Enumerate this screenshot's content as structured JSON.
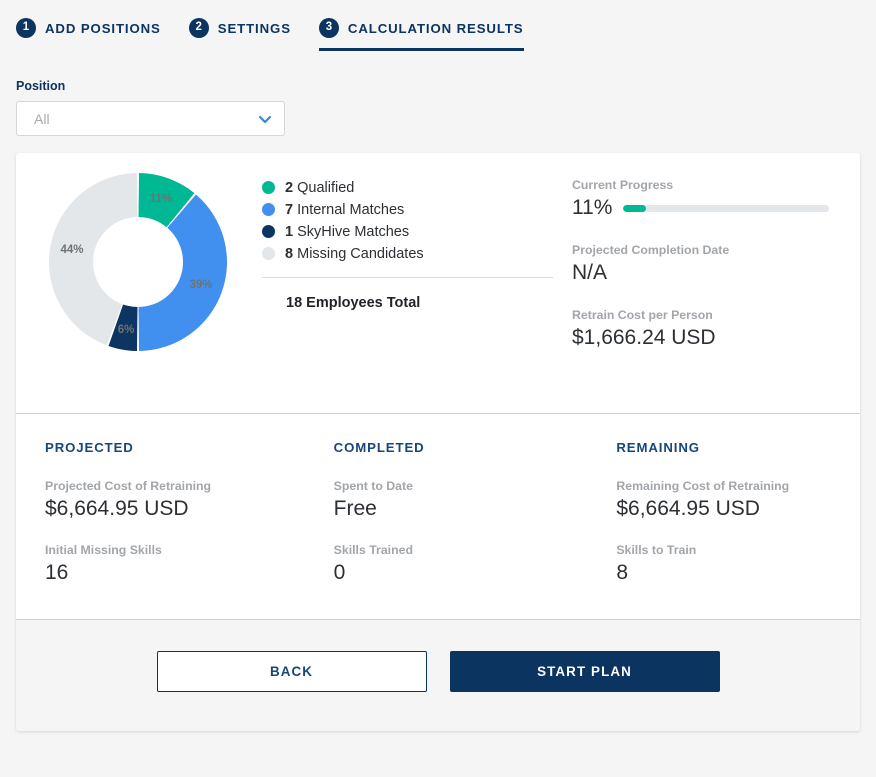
{
  "stepper": {
    "steps": [
      {
        "num": "1",
        "label": "ADD POSITIONS",
        "active": false
      },
      {
        "num": "2",
        "label": "SETTINGS",
        "active": false
      },
      {
        "num": "3",
        "label": "CALCULATION RESULTS",
        "active": true
      }
    ]
  },
  "filter": {
    "label": "Position",
    "value": "All",
    "placeholder": "All"
  },
  "chart_data": {
    "type": "pie",
    "title": "",
    "categories": [
      "Qualified",
      "Internal Matches",
      "SkyHive Matches",
      "Missing Candidates"
    ],
    "values": [
      2,
      7,
      1,
      8
    ],
    "percent_labels": [
      "11%",
      "39%",
      "6%",
      "44%"
    ],
    "colors": [
      "#00b894",
      "#4190f0",
      "#0d3561",
      "#e3e7ea"
    ],
    "total": 18,
    "total_label": "18 Employees Total",
    "legend_position": "right",
    "donut": true
  },
  "legend": [
    {
      "count": "2",
      "label": "Qualified",
      "color": "#00b894"
    },
    {
      "count": "7",
      "label": "Internal Matches",
      "color": "#4190f0"
    },
    {
      "count": "1",
      "label": "SkyHive Matches",
      "color": "#0d3561"
    },
    {
      "count": "8",
      "label": "Missing Candidates",
      "color": "#e3e7ea"
    }
  ],
  "legend_total": "18 Employees Total",
  "side_stats": {
    "progress": {
      "label": "Current Progress",
      "value": "11%",
      "percent": 11
    },
    "completion": {
      "label": "Projected Completion Date",
      "value": "N/A"
    },
    "retrain_cost": {
      "label": "Retrain Cost per Person",
      "value": "$1,666.24 USD"
    }
  },
  "stats_columns": [
    {
      "head": "PROJECTED",
      "items": [
        {
          "label": "Projected Cost of Retraining",
          "value": "$6,664.95 USD"
        },
        {
          "label": "Initial Missing Skills",
          "value": "16"
        }
      ]
    },
    {
      "head": "COMPLETED",
      "items": [
        {
          "label": "Spent to Date",
          "value": "Free"
        },
        {
          "label": "Skills Trained",
          "value": "0"
        }
      ]
    },
    {
      "head": "REMAINING",
      "items": [
        {
          "label": "Remaining Cost of Retraining",
          "value": "$6,664.95 USD"
        },
        {
          "label": "Skills to Train",
          "value": "8"
        }
      ]
    }
  ],
  "footer": {
    "back": "BACK",
    "start": "START PLAN"
  },
  "theme": {
    "navy": "#0b3460",
    "blue": "#4190f0",
    "green": "#00b894",
    "gray": "#e3e7ea"
  }
}
